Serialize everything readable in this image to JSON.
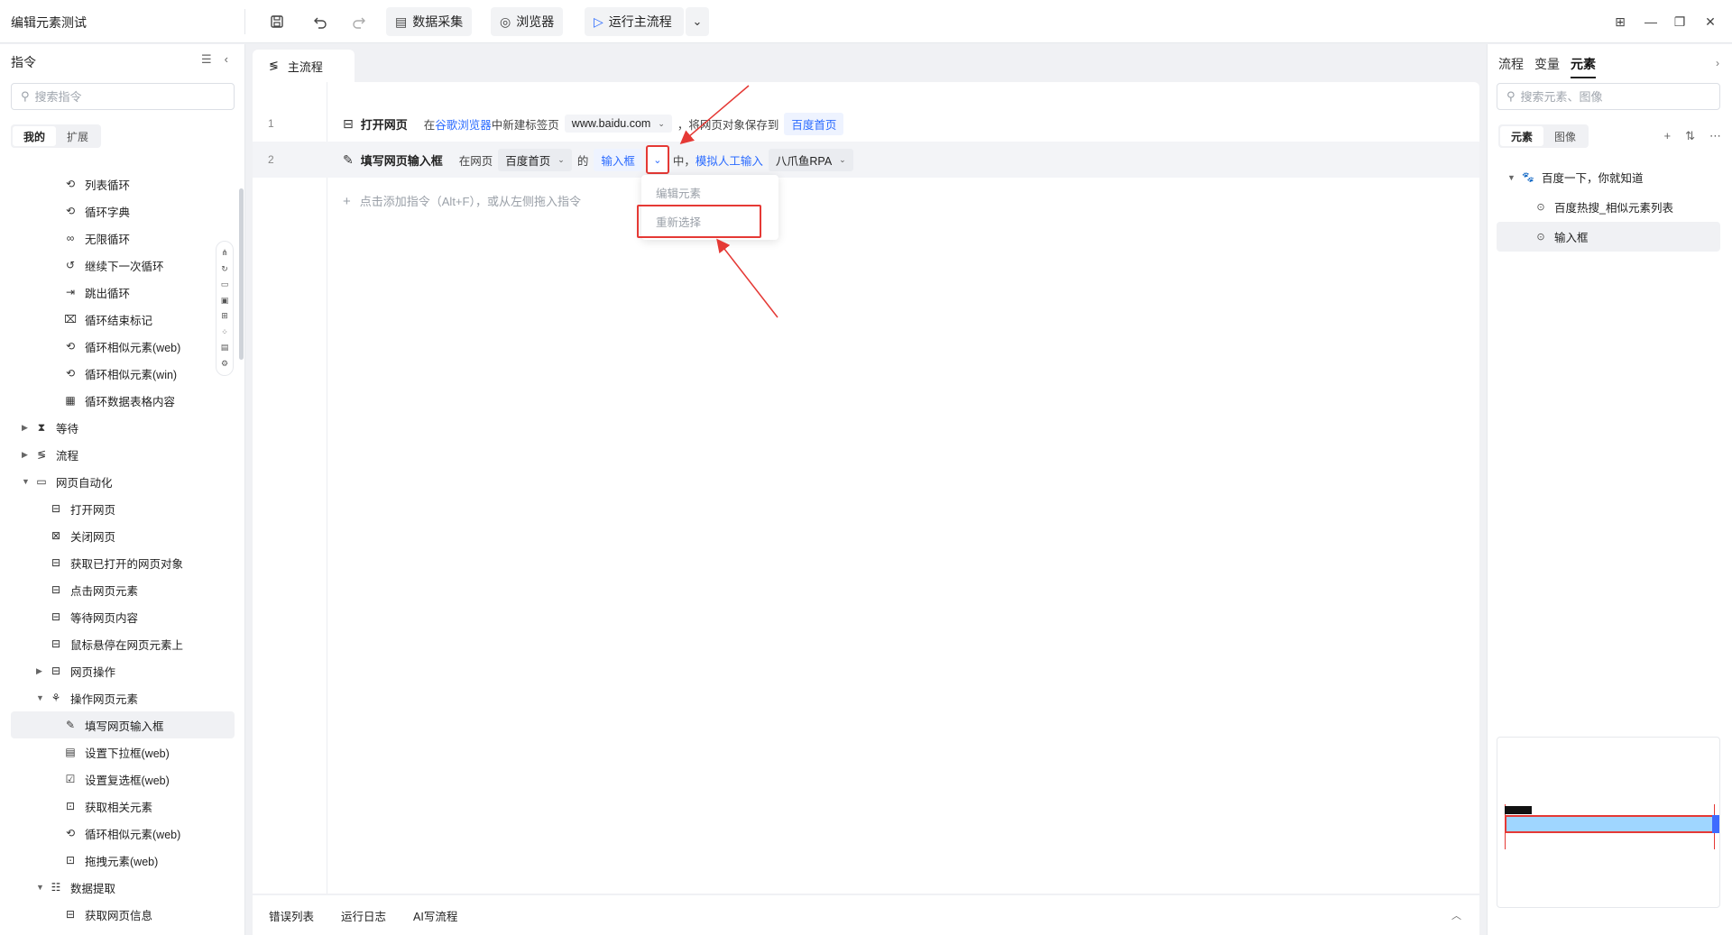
{
  "window": {
    "title": "编辑元素测试",
    "toolbar": {
      "data_collect": "数据采集",
      "browser": "浏览器",
      "run_main": "运行主流程"
    }
  },
  "left_panel": {
    "title": "指令",
    "search_placeholder": "搜索指令",
    "tabs": [
      "我的",
      "扩展"
    ],
    "items": [
      {
        "label": "列表循环",
        "level": 3
      },
      {
        "label": "循环字典",
        "level": 3
      },
      {
        "label": "无限循环",
        "level": 3
      },
      {
        "label": "继续下一次循环",
        "level": 3
      },
      {
        "label": "跳出循环",
        "level": 3
      },
      {
        "label": "循环结束标记",
        "level": 3
      },
      {
        "label": "循环相似元素(web)",
        "level": 3
      },
      {
        "label": "循环相似元素(win)",
        "level": 3
      },
      {
        "label": "循环数据表格内容",
        "level": 3
      },
      {
        "label": "等待",
        "level": 1,
        "caret": "right"
      },
      {
        "label": "流程",
        "level": 1,
        "caret": "right"
      },
      {
        "label": "网页自动化",
        "level": 1,
        "caret": "down"
      },
      {
        "label": "打开网页",
        "level": 2
      },
      {
        "label": "关闭网页",
        "level": 2
      },
      {
        "label": "获取已打开的网页对象",
        "level": 2
      },
      {
        "label": "点击网页元素",
        "level": 2
      },
      {
        "label": "等待网页内容",
        "level": 2
      },
      {
        "label": "鼠标悬停在网页元素上",
        "level": 2
      },
      {
        "label": "网页操作",
        "level": 2,
        "caret": "right"
      },
      {
        "label": "操作网页元素",
        "level": 2,
        "caret": "down"
      },
      {
        "label": "填写网页输入框",
        "level": 3,
        "selected": true
      },
      {
        "label": "设置下拉框(web)",
        "level": 3
      },
      {
        "label": "设置复选框(web)",
        "level": 3
      },
      {
        "label": "获取相关元素",
        "level": 3
      },
      {
        "label": "循环相似元素(web)",
        "level": 3
      },
      {
        "label": "拖拽元素(web)",
        "level": 3
      },
      {
        "label": "数据提取",
        "level": 2,
        "caret": "down"
      },
      {
        "label": "获取网页信息",
        "level": 3
      }
    ]
  },
  "editor": {
    "tab": "主流程",
    "rows": [
      {
        "num": "1",
        "command": "打开网页",
        "parts": {
          "p1": "在",
          "browser": "谷歌浏览器",
          "p2": "中新建标签页",
          "url": "www.baidu.com",
          "p3": "，将网页对象保存到",
          "var": "百度首页"
        }
      },
      {
        "num": "2",
        "command": "填写网页输入框",
        "parts": {
          "p1": "在网页",
          "page": "百度首页",
          "p2": "的",
          "element": "输入框",
          "p3": "中，",
          "mode": "模拟人工输入",
          "value": "八爪鱼RPA"
        }
      }
    ],
    "add_hint": "点击添加指令（Alt+F），或从左侧拖入指令",
    "context_menu": [
      "编辑元素",
      "重新选择"
    ],
    "bottom_tabs": [
      "错误列表",
      "运行日志",
      "AI写流程"
    ]
  },
  "right_panel": {
    "tabs": [
      "流程",
      "变量",
      "元素"
    ],
    "active_tab": "元素",
    "search_placeholder": "搜索元素、图像",
    "subtabs": [
      "元素",
      "图像"
    ],
    "tree": [
      {
        "label": "百度一下，你就知道",
        "level": 0
      },
      {
        "label": "百度热搜_相似元素列表",
        "level": 1
      },
      {
        "label": "输入框",
        "level": 1,
        "selected": true
      }
    ]
  },
  "colors": {
    "accent": "#2b6bff",
    "highlight_red": "#e53935"
  }
}
